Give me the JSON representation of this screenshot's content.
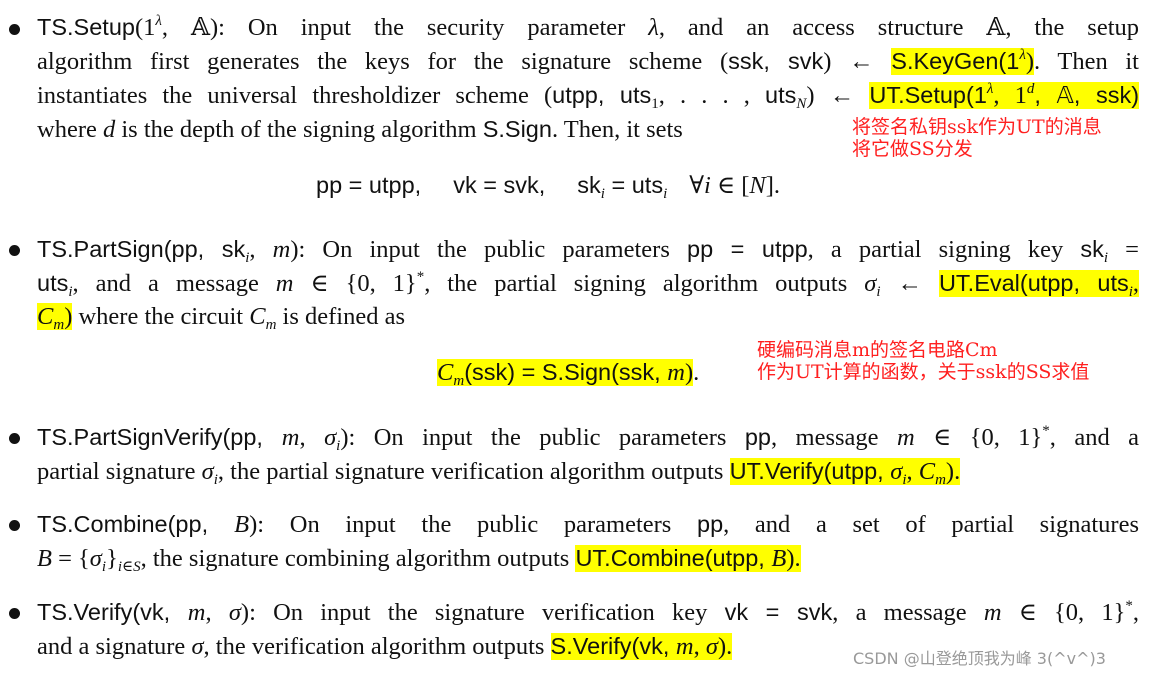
{
  "document": {
    "items": [
      {
        "name": "TS.Setup",
        "lines": [
          [
            "TS.Setup",
            "(1",
            "λ",
            ", 𝔸): On input the security parameter ",
            "λ",
            ", and an access structure 𝔸, the setup"
          ],
          [
            "algorithm first generates the keys for the signature scheme (",
            "ssk, svk",
            ") ← ",
            "S.KeyGen(1",
            "λ",
            ")",
            ". Then it"
          ],
          [
            "instantiates the universal thresholdizer scheme (",
            "utpp, uts",
            "1",
            ", . . . , ",
            "uts",
            "N",
            ") ← ",
            "UT.Setup(1",
            "λ",
            ", 1",
            "d",
            ", 𝔸, ssk)"
          ],
          [
            "where ",
            "d",
            " is the depth of the signing algorithm ",
            "S.Sign",
            ". Then, it sets"
          ]
        ],
        "display": [
          "pp = utpp,",
          "vk = svk,",
          "sk",
          "i",
          " = uts",
          "i",
          "∀",
          "i",
          " ∈ [",
          "N",
          "]."
        ],
        "annotation": [
          "将签名私钥ssk作为UT的消息",
          "将它做SS分发"
        ]
      },
      {
        "name": "TS.PartSign",
        "lines": [
          [
            "TS.PartSign(pp, sk",
            "i",
            ", ",
            "m",
            "): On input the public parameters ",
            "pp = utpp",
            ", a partial signing key ",
            "sk",
            "i",
            " ="
          ],
          [
            "uts",
            "i",
            ", and a message ",
            "m",
            " ∈ {0, 1}",
            "*",
            ", the partial signing algorithm outputs ",
            "σ",
            "i",
            " ← ",
            "UT.Eval(utpp, uts",
            "i",
            ","
          ],
          [
            "C",
            "m",
            ")",
            " where the circuit ",
            "C",
            "m",
            " is defined as"
          ]
        ],
        "display": [
          "C",
          "m",
          "(ssk) = S.Sign(ssk, ",
          "m",
          ")",
          "."
        ],
        "annotation": [
          "硬编码消息m的签名电路Cm",
          "作为UT计算的函数，关于ssk的SS求值"
        ]
      },
      {
        "name": "TS.PartSignVerify",
        "lines": [
          [
            "TS.PartSignVerify(pp, ",
            "m",
            ", ",
            "σ",
            "i",
            "): On input the public parameters ",
            "pp",
            ", message ",
            "m",
            " ∈ {0, 1}",
            "*",
            ", and a"
          ],
          [
            "partial signature ",
            "σ",
            "i",
            ", the partial signature verification algorithm outputs ",
            "UT.Verify(utpp, ",
            "σ",
            "i",
            ", ",
            "C",
            "m",
            ")."
          ]
        ]
      },
      {
        "name": "TS.Combine",
        "lines": [
          [
            "TS.Combine(pp, ",
            "B",
            "): On input the public parameters ",
            "pp",
            ", and a set of partial signatures"
          ],
          [
            "B",
            " = {",
            "σ",
            "i",
            "}",
            "i∈S",
            ", the signature combining algorithm outputs ",
            "UT.Combine(utpp, ",
            "B",
            ")."
          ]
        ]
      },
      {
        "name": "TS.Verify",
        "lines": [
          [
            "TS.Verify(vk, ",
            "m",
            ", ",
            "σ",
            "): On input the signature verification key ",
            "vk = svk",
            ", a message ",
            "m",
            " ∈ {0, 1}",
            "*",
            ","
          ],
          [
            "and a signature ",
            "σ",
            ", the verification algorithm outputs ",
            "S.Verify(vk, ",
            "m",
            ", ",
            "σ",
            ")."
          ]
        ]
      }
    ],
    "watermark": "CSDN @山登绝顶我为峰 3(^v^)3"
  },
  "colors": {
    "highlight": "#ffff00",
    "annotation": "#ff2020",
    "text": "#111111",
    "watermark": "#999999"
  }
}
